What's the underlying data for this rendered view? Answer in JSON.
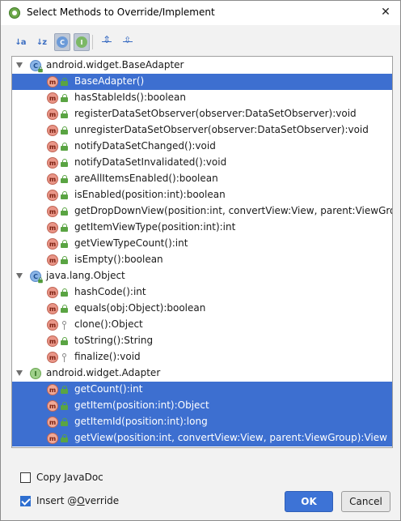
{
  "dialog": {
    "title": "Select Methods to Override/Implement",
    "close_glyph": "✕"
  },
  "toolbar": {
    "sort_alpha": "↓a",
    "sort_alpha_icon": "sort-alphabetically-icon",
    "sort_visibility": "↓z",
    "show_classes": "C",
    "show_interfaces": "I",
    "expand_all": "",
    "collapse_all": ""
  },
  "tree": {
    "groups": [
      {
        "kind": "class",
        "icon_letter": "C",
        "label": "android.widget.BaseAdapter",
        "methods": [
          {
            "label": "BaseAdapter()",
            "access": "public",
            "selected": true
          },
          {
            "label": "hasStableIds():boolean",
            "access": "public"
          },
          {
            "label": "registerDataSetObserver(observer:DataSetObserver):void",
            "access": "public"
          },
          {
            "label": "unregisterDataSetObserver(observer:DataSetObserver):void",
            "access": "public"
          },
          {
            "label": "notifyDataSetChanged():void",
            "access": "public"
          },
          {
            "label": "notifyDataSetInvalidated():void",
            "access": "public"
          },
          {
            "label": "areAllItemsEnabled():boolean",
            "access": "public"
          },
          {
            "label": "isEnabled(position:int):boolean",
            "access": "public"
          },
          {
            "label": "getDropDownView(position:int, convertView:View, parent:ViewGroup):View",
            "access": "public"
          },
          {
            "label": "getItemViewType(position:int):int",
            "access": "public"
          },
          {
            "label": "getViewTypeCount():int",
            "access": "public"
          },
          {
            "label": "isEmpty():boolean",
            "access": "public"
          }
        ]
      },
      {
        "kind": "class",
        "icon_letter": "C",
        "label": "java.lang.Object",
        "methods": [
          {
            "label": "hashCode():int",
            "access": "public"
          },
          {
            "label": "equals(obj:Object):boolean",
            "access": "public"
          },
          {
            "label": "clone():Object",
            "access": "protected"
          },
          {
            "label": "toString():String",
            "access": "public"
          },
          {
            "label": "finalize():void",
            "access": "protected"
          }
        ]
      },
      {
        "kind": "interface",
        "icon_letter": "I",
        "label": "android.widget.Adapter",
        "methods": [
          {
            "label": "getCount():int",
            "access": "public",
            "selected": true,
            "abstract": true
          },
          {
            "label": "getItem(position:int):Object",
            "access": "public",
            "selected": true,
            "abstract": true
          },
          {
            "label": "getItemId(position:int):long",
            "access": "public",
            "selected": true,
            "abstract": true
          },
          {
            "label": "getView(position:int, convertView:View, parent:ViewGroup):View",
            "access": "public",
            "selected": true,
            "abstract": true
          }
        ]
      }
    ],
    "method_icon_letter": "m"
  },
  "options": {
    "copy_javadoc": {
      "label": "Copy JavaDoc",
      "checked": false
    },
    "insert_override": {
      "label_pre": "Insert @",
      "label_u": "O",
      "label_post": "verride",
      "checked": true
    }
  },
  "buttons": {
    "ok": "OK",
    "cancel": "Cancel"
  },
  "colors": {
    "selection": "#3d6fd0",
    "method_icon": "#e99587",
    "class_icon": "#8ab4e6",
    "interface_icon": "#9fd08a",
    "ok_button": "#3d73d6"
  }
}
